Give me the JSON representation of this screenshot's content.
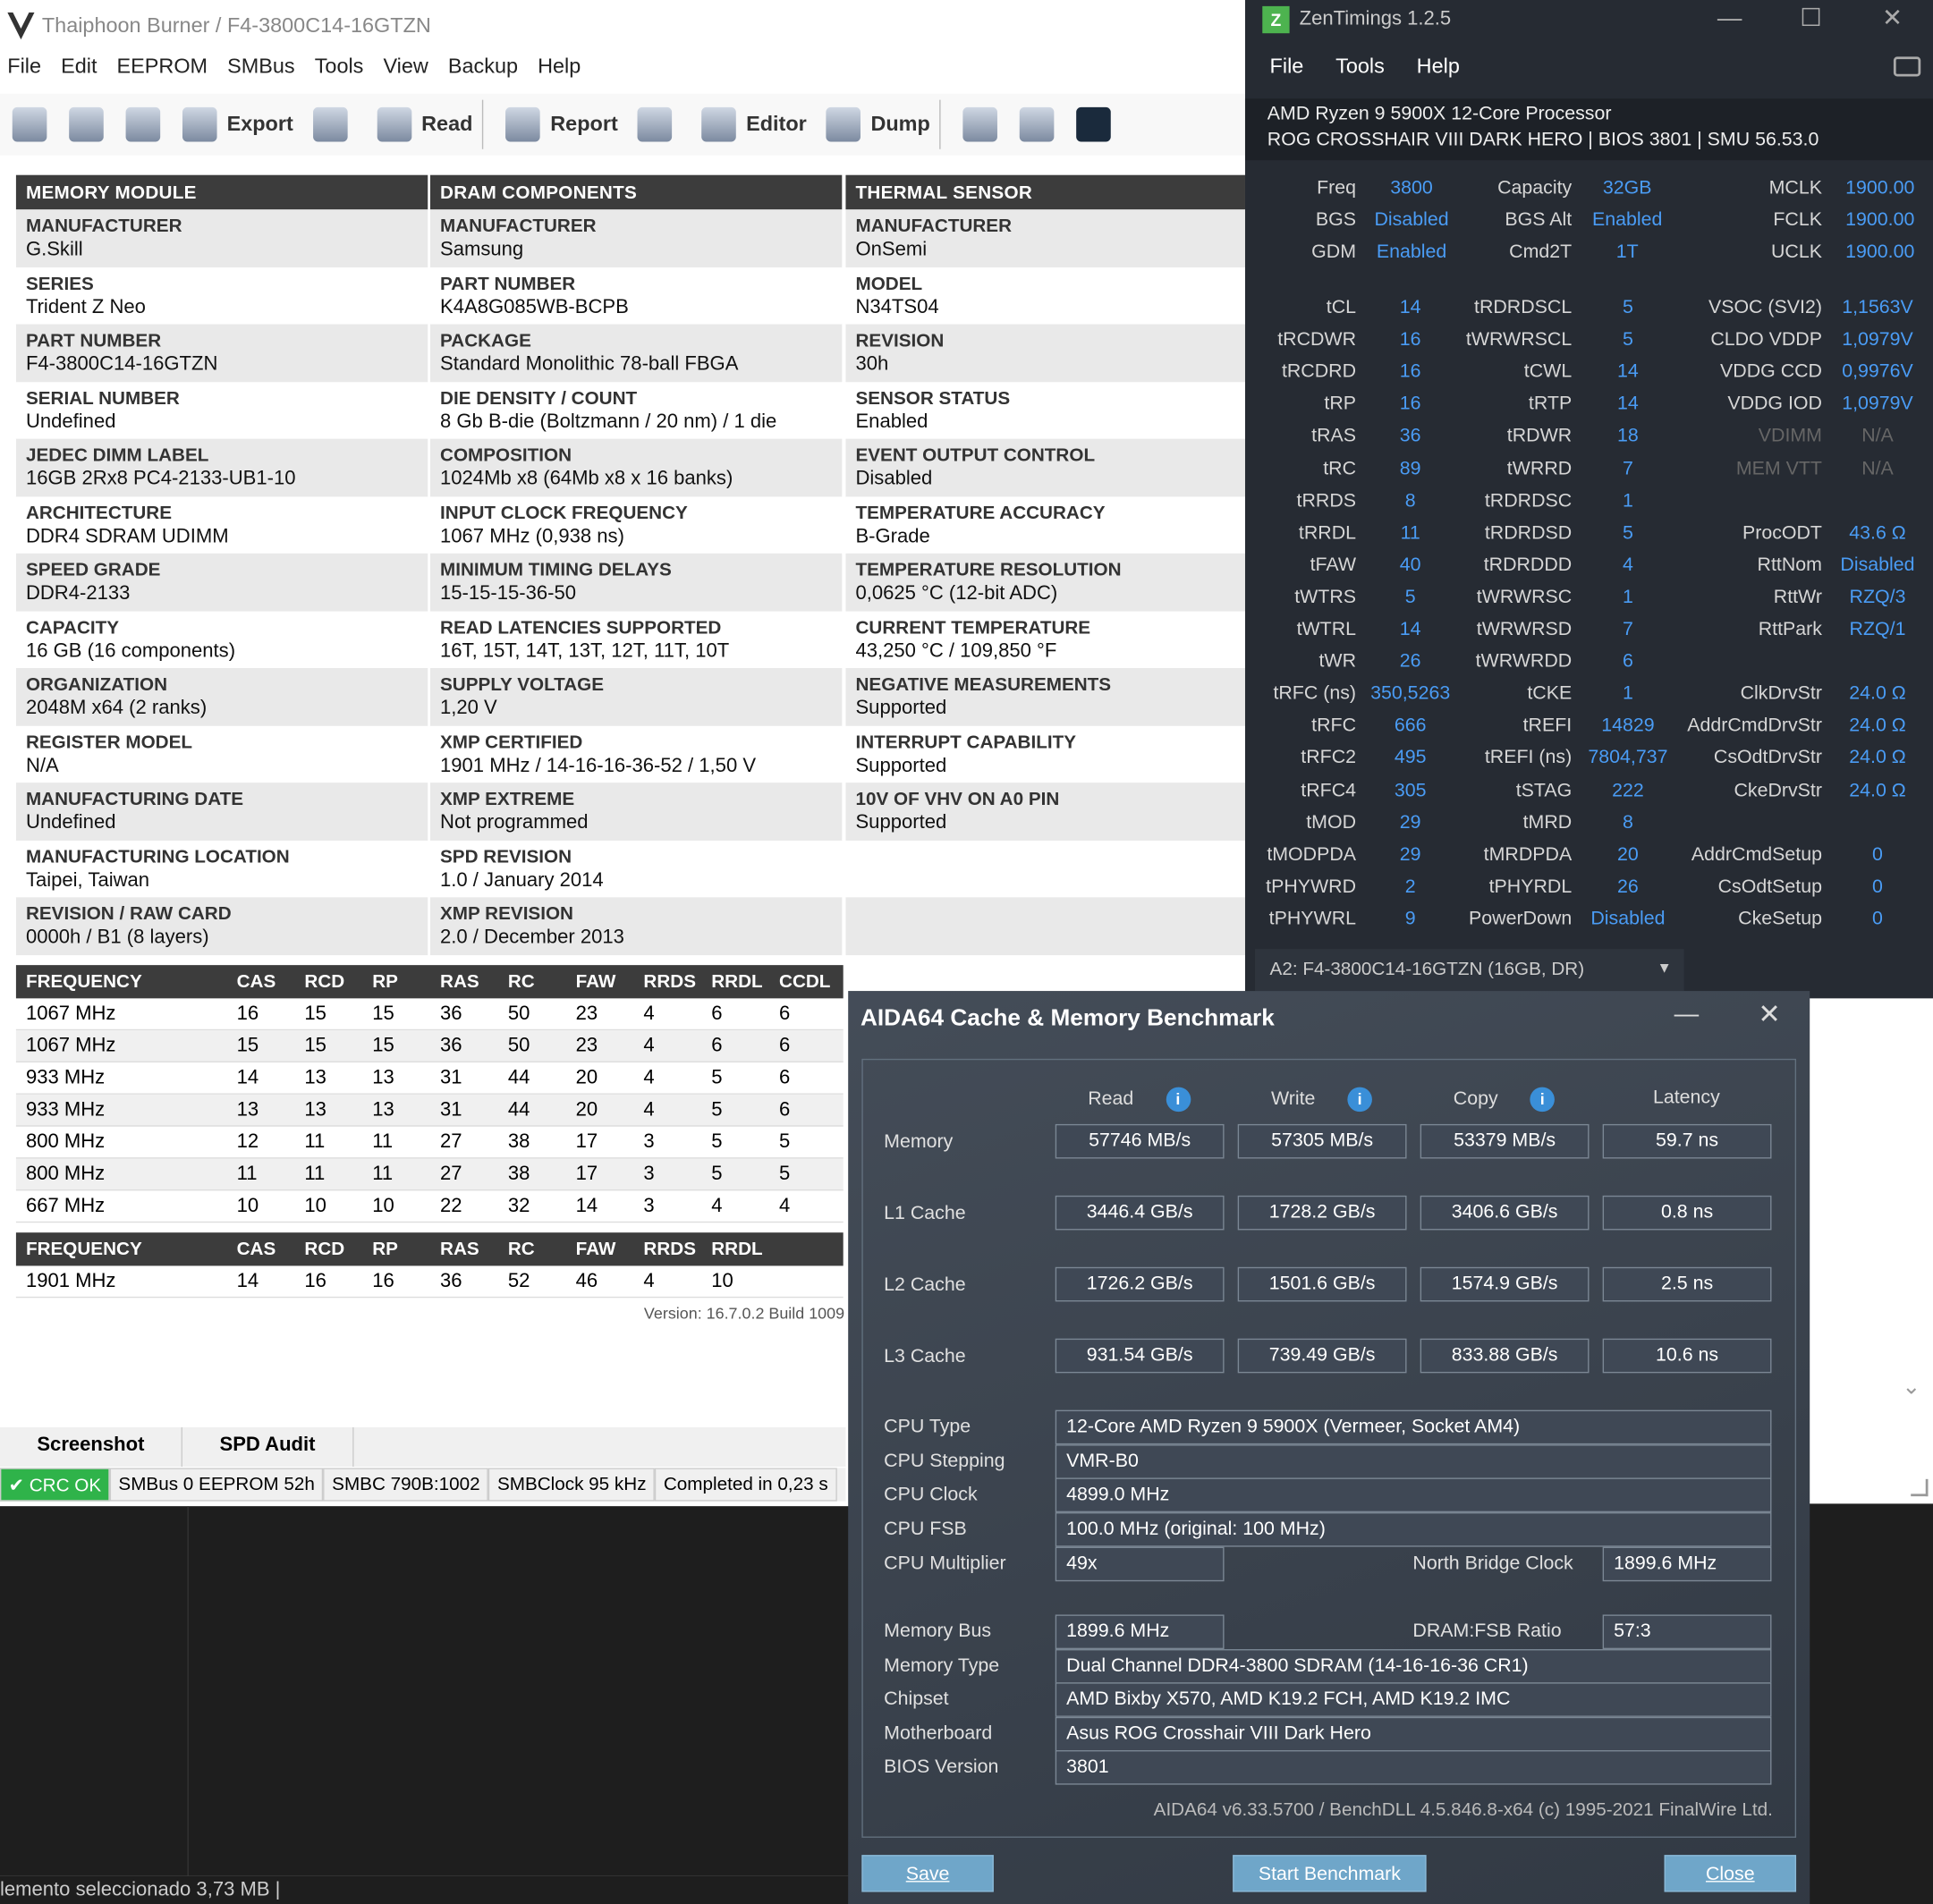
{
  "thaiphoon": {
    "title": "Thaiphoon Burner / F4-3800C14-16GTZN",
    "menu": [
      "File",
      "Edit",
      "EEPROM",
      "SMBus",
      "Tools",
      "View",
      "Backup",
      "Help"
    ],
    "toolbar": {
      "export": "Export",
      "read": "Read",
      "report": "Report",
      "editor": "Editor",
      "dump": "Dump"
    },
    "module": {
      "head": "MEMORY MODULE",
      "rows": [
        [
          "MANUFACTURER",
          "G.Skill"
        ],
        [
          "SERIES",
          "Trident Z Neo"
        ],
        [
          "PART NUMBER",
          "F4-3800C14-16GTZN"
        ],
        [
          "SERIAL NUMBER",
          "Undefined"
        ],
        [
          "JEDEC DIMM LABEL",
          "16GB 2Rx8 PC4-2133-UB1-10"
        ],
        [
          "ARCHITECTURE",
          "DDR4 SDRAM UDIMM"
        ],
        [
          "SPEED GRADE",
          "DDR4-2133"
        ],
        [
          "CAPACITY",
          "16 GB (16 components)"
        ],
        [
          "ORGANIZATION",
          "2048M x64 (2 ranks)"
        ],
        [
          "REGISTER MODEL",
          "N/A"
        ],
        [
          "MANUFACTURING DATE",
          "Undefined"
        ],
        [
          "MANUFACTURING LOCATION",
          "Taipei, Taiwan"
        ],
        [
          "REVISION / RAW CARD",
          "0000h / B1 (8 layers)"
        ]
      ]
    },
    "dram": {
      "head": "DRAM COMPONENTS",
      "rows": [
        [
          "MANUFACTURER",
          "Samsung"
        ],
        [
          "PART NUMBER",
          "K4A8G085WB-BCPB"
        ],
        [
          "PACKAGE",
          "Standard Monolithic 78-ball FBGA"
        ],
        [
          "DIE DENSITY / COUNT",
          "8 Gb B-die (Boltzmann / 20 nm) / 1 die"
        ],
        [
          "COMPOSITION",
          "1024Mb x8 (64Mb x8 x 16 banks)"
        ],
        [
          "INPUT CLOCK FREQUENCY",
          "1067 MHz (0,938 ns)"
        ],
        [
          "MINIMUM TIMING DELAYS",
          "15-15-15-36-50"
        ],
        [
          "READ LATENCIES SUPPORTED",
          "16T, 15T, 14T, 13T, 12T, 11T, 10T"
        ],
        [
          "SUPPLY VOLTAGE",
          "1,20 V"
        ],
        [
          "XMP CERTIFIED",
          "1901 MHz / 14-16-16-36-52 / 1,50 V"
        ],
        [
          "XMP EXTREME",
          "Not programmed"
        ],
        [
          "SPD REVISION",
          "1.0 / January 2014"
        ],
        [
          "XMP REVISION",
          "2.0 / December 2013"
        ]
      ]
    },
    "thermal": {
      "head": "THERMAL SENSOR",
      "rows": [
        [
          "MANUFACTURER",
          "OnSemi"
        ],
        [
          "MODEL",
          "N34TS04"
        ],
        [
          "REVISION",
          "30h"
        ],
        [
          "SENSOR STATUS",
          "Enabled"
        ],
        [
          "EVENT OUTPUT CONTROL",
          "Disabled"
        ],
        [
          "TEMPERATURE ACCURACY",
          "B-Grade"
        ],
        [
          "TEMPERATURE RESOLUTION",
          "0,0625 °C (12-bit ADC)"
        ],
        [
          "CURRENT TEMPERATURE",
          "43,250 °C / 109,850 °F"
        ],
        [
          "NEGATIVE MEASUREMENTS",
          "Supported"
        ],
        [
          "INTERRUPT CAPABILITY",
          "Supported"
        ],
        [
          "10V OF VHV ON A0 PIN",
          "Supported"
        ],
        [
          "",
          ""
        ],
        [
          "",
          ""
        ]
      ]
    },
    "freq1": {
      "cols": [
        "FREQUENCY",
        "CAS",
        "RCD",
        "RP",
        "RAS",
        "RC",
        "FAW",
        "RRDS",
        "RRDL",
        "CCDL"
      ],
      "rows": [
        [
          "1067 MHz",
          "16",
          "15",
          "15",
          "36",
          "50",
          "23",
          "4",
          "6",
          "6"
        ],
        [
          "1067 MHz",
          "15",
          "15",
          "15",
          "36",
          "50",
          "23",
          "4",
          "6",
          "6"
        ],
        [
          "933 MHz",
          "14",
          "13",
          "13",
          "31",
          "44",
          "20",
          "4",
          "5",
          "6"
        ],
        [
          "933 MHz",
          "13",
          "13",
          "13",
          "31",
          "44",
          "20",
          "4",
          "5",
          "6"
        ],
        [
          "800 MHz",
          "12",
          "11",
          "11",
          "27",
          "38",
          "17",
          "3",
          "5",
          "5"
        ],
        [
          "800 MHz",
          "11",
          "11",
          "11",
          "27",
          "38",
          "17",
          "3",
          "5",
          "5"
        ],
        [
          "667 MHz",
          "10",
          "10",
          "10",
          "22",
          "32",
          "14",
          "3",
          "4",
          "4"
        ]
      ]
    },
    "freq2": {
      "cols": [
        "FREQUENCY",
        "CAS",
        "RCD",
        "RP",
        "RAS",
        "RC",
        "FAW",
        "RRDS",
        "RRDL"
      ],
      "rows": [
        [
          "1901 MHz",
          "14",
          "16",
          "16",
          "36",
          "52",
          "46",
          "4",
          "10"
        ]
      ]
    },
    "version": "Version: 16.7.0.2 Build 1009",
    "tabs": [
      "Screenshot",
      "SPD Audit"
    ],
    "status": [
      "✔ CRC OK",
      "SMBus 0 EEPROM 52h",
      "SMBC 790B:1002",
      "SMBClock 95 kHz",
      "Completed in 0,23 s"
    ],
    "bottom_status": "lemento seleccionado  3,73 MB  |"
  },
  "zen": {
    "title": "ZenTimings 1.2.5",
    "menu": [
      "File",
      "Tools",
      "Help"
    ],
    "cpu": "AMD Ryzen 9 5900X 12-Core Processor",
    "board": "ROG CROSSHAIR VIII DARK HERO | BIOS 3801 | SMU 56.53.0",
    "top": [
      [
        "Freq",
        "3800",
        "Capacity",
        "32GB",
        "MCLK",
        "1900.00"
      ],
      [
        "BGS",
        "Disabled",
        "BGS Alt",
        "Enabled",
        "FCLK",
        "1900.00"
      ],
      [
        "GDM",
        "Enabled",
        "Cmd2T",
        "1T",
        "UCLK",
        "1900.00"
      ]
    ],
    "rows": [
      [
        "tCL",
        "14",
        "tRDRDSCL",
        "5",
        "VSOC (SVI2)",
        "1,1563V"
      ],
      [
        "tRCDWR",
        "16",
        "tWRWRSCL",
        "5",
        "CLDO VDDP",
        "1,0979V"
      ],
      [
        "tRCDRD",
        "16",
        "tCWL",
        "14",
        "VDDG CCD",
        "0,9976V"
      ],
      [
        "tRP",
        "16",
        "tRTP",
        "14",
        "VDDG IOD",
        "1,0979V"
      ],
      [
        "tRAS",
        "36",
        "tRDWR",
        "18",
        "VDIMM",
        "N/A"
      ],
      [
        "tRC",
        "89",
        "tWRRD",
        "7",
        "MEM VTT",
        "N/A"
      ],
      [
        "tRRDS",
        "8",
        "tRDRDSC",
        "1",
        "",
        ""
      ],
      [
        "tRRDL",
        "11",
        "tRDRDSD",
        "5",
        "ProcODT",
        "43.6 Ω"
      ],
      [
        "tFAW",
        "40",
        "tRDRDDD",
        "4",
        "RttNom",
        "Disabled"
      ],
      [
        "tWTRS",
        "5",
        "tWRWRSC",
        "1",
        "RttWr",
        "RZQ/3"
      ],
      [
        "tWTRL",
        "14",
        "tWRWRSD",
        "7",
        "RttPark",
        "RZQ/1"
      ],
      [
        "tWR",
        "26",
        "tWRWRDD",
        "6",
        "",
        ""
      ],
      [
        "tRFC (ns)",
        "350,5263",
        "tCKE",
        "1",
        "ClkDrvStr",
        "24.0 Ω"
      ],
      [
        "tRFC",
        "666",
        "tREFI",
        "14829",
        "AddrCmdDrvStr",
        "24.0 Ω"
      ],
      [
        "tRFC2",
        "495",
        "tREFI (ns)",
        "7804,737",
        "CsOdtDrvStr",
        "24.0 Ω"
      ],
      [
        "tRFC4",
        "305",
        "tSTAG",
        "222",
        "CkeDrvStr",
        "24.0 Ω"
      ],
      [
        "tMOD",
        "29",
        "tMRD",
        "8",
        "",
        ""
      ],
      [
        "tMODPDA",
        "29",
        "tMRDPDA",
        "20",
        "AddrCmdSetup",
        "0"
      ],
      [
        "tPHYWRD",
        "2",
        "tPHYRDL",
        "26",
        "CsOdtSetup",
        "0"
      ],
      [
        "tPHYWRL",
        "9",
        "PowerDown",
        "Disabled",
        "CkeSetup",
        "0"
      ]
    ],
    "dropdown": "A2: F4-3800C14-16GTZN (16GB, DR)"
  },
  "aida": {
    "title": "AIDA64 Cache & Memory Benchmark",
    "headers": [
      "Read",
      "Write",
      "Copy",
      "Latency"
    ],
    "rows": [
      [
        "Memory",
        "57746 MB/s",
        "57305 MB/s",
        "53379 MB/s",
        "59.7 ns"
      ],
      [
        "L1 Cache",
        "3446.4 GB/s",
        "1728.2 GB/s",
        "3406.6 GB/s",
        "0.8 ns"
      ],
      [
        "L2 Cache",
        "1726.2 GB/s",
        "1501.6 GB/s",
        "1574.9 GB/s",
        "2.5 ns"
      ],
      [
        "L3 Cache",
        "931.54 GB/s",
        "739.49 GB/s",
        "833.88 GB/s",
        "10.6 ns"
      ]
    ],
    "info": {
      "cpu_type_l": "CPU Type",
      "cpu_type": "12-Core AMD Ryzen 9 5900X  (Vermeer, Socket AM4)",
      "cpu_step_l": "CPU Stepping",
      "cpu_step": "VMR-B0",
      "cpu_clock_l": "CPU Clock",
      "cpu_clock": "4899.0 MHz",
      "cpu_fsb_l": "CPU FSB",
      "cpu_fsb": "100.0 MHz  (original: 100 MHz)",
      "cpu_mult_l": "CPU Multiplier",
      "cpu_mult": "49x",
      "nb_l": "North Bridge Clock",
      "nb": "1899.6 MHz",
      "mem_bus_l": "Memory Bus",
      "mem_bus": "1899.6 MHz",
      "ratio_l": "DRAM:FSB Ratio",
      "ratio": "57:3",
      "mem_type_l": "Memory Type",
      "mem_type": "Dual Channel DDR4-3800 SDRAM  (14-16-16-36 CR1)",
      "chipset_l": "Chipset",
      "chipset": "AMD Bixby X570, AMD K19.2 FCH, AMD K19.2 IMC",
      "mb_l": "Motherboard",
      "mb": "Asus ROG Crosshair VIII Dark Hero",
      "bios_l": "BIOS Version",
      "bios": "3801"
    },
    "footer": "AIDA64 v6.33.5700 / BenchDLL 4.5.846.8-x64  (c) 1995-2021 FinalWire Ltd.",
    "buttons": {
      "save": "Save",
      "start": "Start Benchmark",
      "close": "Close"
    }
  }
}
